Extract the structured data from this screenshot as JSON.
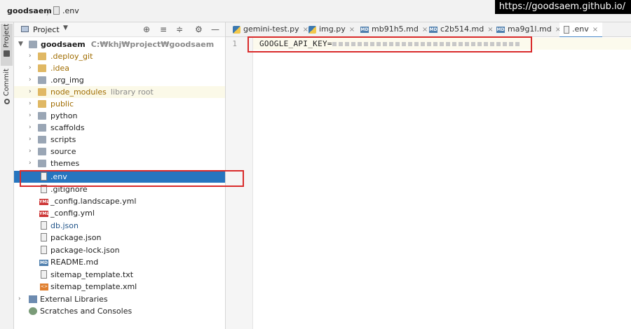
{
  "breadcrumb": {
    "project": "goodsaem",
    "separator": "〉",
    "file": ".env"
  },
  "watermark": "https://goodsaem.github.io/",
  "left_strip": {
    "project_tab": "Project",
    "commit_tab": "Commit"
  },
  "project_panel": {
    "title": "Project",
    "tools": [
      "⊕",
      "≡",
      "≑",
      "⚙",
      "—"
    ],
    "root": {
      "name": "goodsaem",
      "path": "C:₩khj₩project₩goodsaem"
    },
    "items": [
      {
        "label": ".deploy_git",
        "kind": "folder"
      },
      {
        "label": ".idea",
        "kind": "folder"
      },
      {
        "label": ".org_img",
        "kind": "folder"
      },
      {
        "label": "node_modules",
        "kind": "folder",
        "tag": "library root"
      },
      {
        "label": "public",
        "kind": "folder"
      },
      {
        "label": "python",
        "kind": "folder"
      },
      {
        "label": "scaffolds",
        "kind": "folder"
      },
      {
        "label": "scripts",
        "kind": "folder"
      },
      {
        "label": "source",
        "kind": "folder"
      },
      {
        "label": "themes",
        "kind": "folder"
      },
      {
        "label": ".env",
        "kind": "file",
        "selected": true
      },
      {
        "label": ".gitignore",
        "kind": "file"
      },
      {
        "label": "_config.landscape.yml",
        "kind": "yml"
      },
      {
        "label": "_config.yml",
        "kind": "yml"
      },
      {
        "label": "db.json",
        "kind": "json"
      },
      {
        "label": "package.json",
        "kind": "json"
      },
      {
        "label": "package-lock.json",
        "kind": "json"
      },
      {
        "label": "README.md",
        "kind": "md"
      },
      {
        "label": "sitemap_template.txt",
        "kind": "file"
      },
      {
        "label": "sitemap_template.xml",
        "kind": "xml"
      }
    ],
    "external_libraries": "External Libraries",
    "scratches": "Scratches and Consoles"
  },
  "icon_text": {
    "yml": "YML",
    "md": "MD",
    "xml": "<>"
  },
  "tabs": [
    {
      "label": "gemini-test.py",
      "icon": "python-file-icon"
    },
    {
      "label": "img.py",
      "icon": "python-file-icon"
    },
    {
      "label": "mb91h5.md",
      "icon": "markdown-file-icon"
    },
    {
      "label": "c2b514.md",
      "icon": "markdown-file-icon"
    },
    {
      "label": "ma9g1l.md",
      "icon": "markdown-file-icon"
    },
    {
      "label": ".env",
      "icon": "text-file-icon",
      "active": true
    }
  ],
  "tab_close": "×",
  "editor": {
    "line_number": "1",
    "code_key": "GOOGLE_API_KEY="
  },
  "colors": {
    "selection": "#2675bf",
    "highlight_box": "#d92b2b",
    "active_tab_underline": "#4a88c7"
  }
}
